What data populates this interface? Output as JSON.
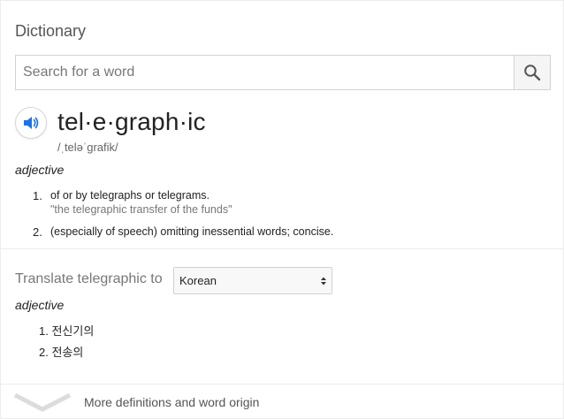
{
  "panel": {
    "title": "Dictionary"
  },
  "search": {
    "placeholder": "Search for a word",
    "value": ""
  },
  "entry": {
    "word": "tel·e·graph·ic",
    "pronunciation": "/ˌteləˈgrafik/",
    "part_of_speech": "adjective",
    "definitions": [
      {
        "number": "1.",
        "text": "of or by telegraphs or telegrams.",
        "example": "\"the telegraphic transfer of the funds\""
      },
      {
        "number": "2.",
        "text": "(especially of speech) omitting inessential words; concise.",
        "example": ""
      }
    ]
  },
  "translate": {
    "label": "Translate telegraphic to",
    "selected_language": "Korean",
    "part_of_speech": "adjective",
    "items": [
      {
        "number": "1.",
        "text": "전신기의"
      },
      {
        "number": "2.",
        "text": "전송의"
      }
    ]
  },
  "footer": {
    "more_label": "More definitions and word origin"
  },
  "icons": {
    "search": "search-icon",
    "speaker": "speaker-icon",
    "select_arrows": "updown-arrows-icon",
    "expand": "chevron-down-icon"
  },
  "colors": {
    "accent": "#1a73e8",
    "muted_text": "#777777",
    "border": "#d2d2d2"
  }
}
